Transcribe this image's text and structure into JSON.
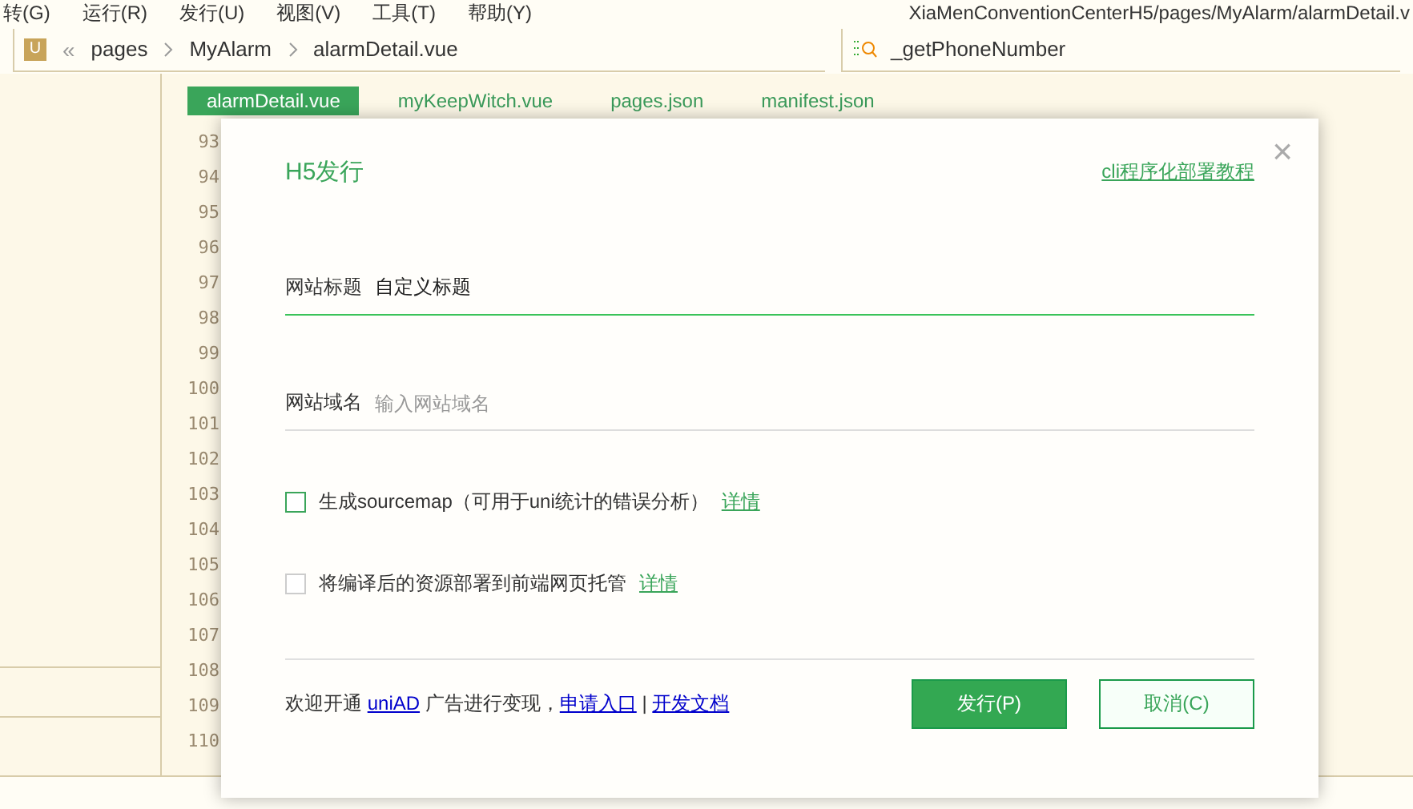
{
  "menu": [
    "转(G)",
    "运行(R)",
    "发行(U)",
    "视图(V)",
    "工具(T)",
    "帮助(Y)"
  ],
  "window_title": "XiaMenConventionCenterH5/pages/MyAlarm/alarmDetail.v",
  "file_badge": "U",
  "collapse": "«",
  "breadcrumb": [
    "pages",
    "MyAlarm",
    "alarmDetail.vue"
  ],
  "symbol_search": {
    "value": "_getPhoneNumber"
  },
  "tabs": [
    {
      "label": "alarmDetail.vue",
      "selected": true
    },
    {
      "label": "myKeepWitch.vue",
      "selected": false
    },
    {
      "label": "pages.json",
      "selected": false
    },
    {
      "label": "manifest.json",
      "selected": false
    }
  ],
  "line_numbers": [
    "93",
    "94",
    "95",
    "96",
    "97",
    "98",
    "99",
    "100",
    "101",
    "102",
    "103",
    "104",
    "105",
    "106",
    "107",
    "108",
    "109",
    "110"
  ],
  "dialog": {
    "title": "H5发行",
    "help_link": "cli程序化部署教程",
    "close": "×",
    "fields": [
      {
        "label": "网站标题",
        "value": "自定义标题",
        "focused": true
      },
      {
        "label": "网站域名",
        "placeholder": "输入网站域名",
        "focused": false
      }
    ],
    "options": [
      {
        "label": "生成sourcemap（可用于uni统计的错误分析）",
        "link": "详情",
        "checked": false,
        "disabled": false
      },
      {
        "label": "将编译后的资源部署到前端网页托管",
        "link": "详情",
        "checked": false,
        "disabled": true
      }
    ],
    "footer": [
      {
        "kind": "text",
        "text": "欢迎开通 "
      },
      {
        "kind": "link",
        "text": "uniAD"
      },
      {
        "kind": "text",
        "text": " 广告进行变现，"
      },
      {
        "kind": "link",
        "text": "申请入口"
      },
      {
        "kind": "text",
        "text": " | "
      },
      {
        "kind": "link",
        "text": "开发文档"
      }
    ],
    "buttons": [
      {
        "label": "发行(P)",
        "kind": "primary"
      },
      {
        "label": "取消(C)",
        "kind": "secondary"
      }
    ]
  }
}
